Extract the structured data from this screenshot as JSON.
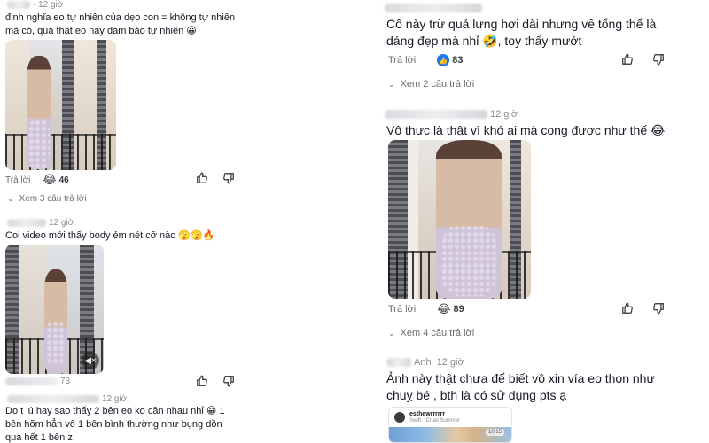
{
  "left": {
    "comments": [
      {
        "time": "· 12 giờ",
        "text": "định nghĩa eo tự nhiên của dẹo con = không tự nhiên mà có, quả thật eo này dám bảo tự nhiên 😀",
        "reply_label": "Trả lời",
        "reaction_emoji": "😂",
        "reaction_count": "46",
        "view_replies": "Xem 3 câu trả lời"
      },
      {
        "time": "12 giờ",
        "text": "Coi video mới thấy body ẻm nét cỡ nào 🫣🫣🔥",
        "reply_label": "",
        "reaction_emoji": "",
        "reaction_count": "73",
        "view_replies": ""
      },
      {
        "time": "12 giờ",
        "text": "Do t lú hay sao thấy 2 bên eo ko cân nhau nhỉ 😀 1 bên hõm hẳn vô 1 bên bình thường như bụng dồn qua hết 1 bên z"
      }
    ]
  },
  "right": {
    "comments": [
      {
        "text": "Cô này trừ quả lưng hơi dài nhưng về tổng thể là dáng đẹp mà nhỉ 🤣, toy thấy mướt",
        "reply_label": "Trả lời",
        "reaction_emoji": "👍",
        "reaction_count": "83",
        "view_replies": "Xem 2 câu trả lời"
      },
      {
        "time": "12 giờ",
        "text": "Vô thực là thật vì khó ai mà cong được như thế 😂",
        "reply_label": "Trả lời",
        "reaction_emoji": "😂",
        "reaction_count": "89",
        "view_replies": "Xem 4 câu trả lời"
      },
      {
        "name": "Anh",
        "time": "12 giờ",
        "text": "Ảnh này thật chưa để biết vô xin vía eo thon như chuỵ bé , bth là có sử dụng pts ạ",
        "preview": {
          "account": "esthewrrrrrr",
          "song": "Swift · Cruel Summer",
          "duration": "10:15"
        }
      }
    ]
  }
}
